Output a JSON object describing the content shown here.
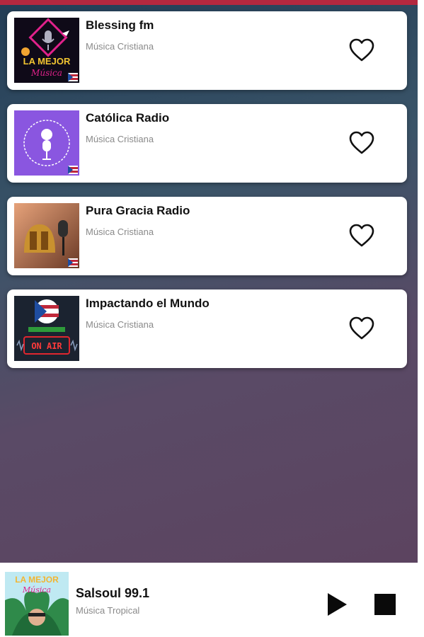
{
  "accent_color": "#b4283f",
  "stations": [
    {
      "title": "Blessing fm",
      "genre": "Música Cristiana",
      "logo_text": "LA MEJOR",
      "logo_script": "Música",
      "favorite_icon": "heart-outline-icon"
    },
    {
      "title": "Católica Radio",
      "genre": "Música Cristiana",
      "logo_text": "",
      "favorite_icon": "heart-outline-icon"
    },
    {
      "title": "Pura Gracia Radio",
      "genre": "Música Cristiana",
      "logo_text": "",
      "favorite_icon": "heart-outline-icon"
    },
    {
      "title": "Impactando el Mundo",
      "genre": "Música Cristiana",
      "logo_text": "ON AIR",
      "favorite_icon": "heart-outline-icon"
    }
  ],
  "now_playing": {
    "title": "Salsoul 99.1",
    "genre": "Música Tropical",
    "art_text": "LA MEJOR",
    "art_script": "Música",
    "play_icon": "play-icon",
    "stop_icon": "stop-icon"
  }
}
